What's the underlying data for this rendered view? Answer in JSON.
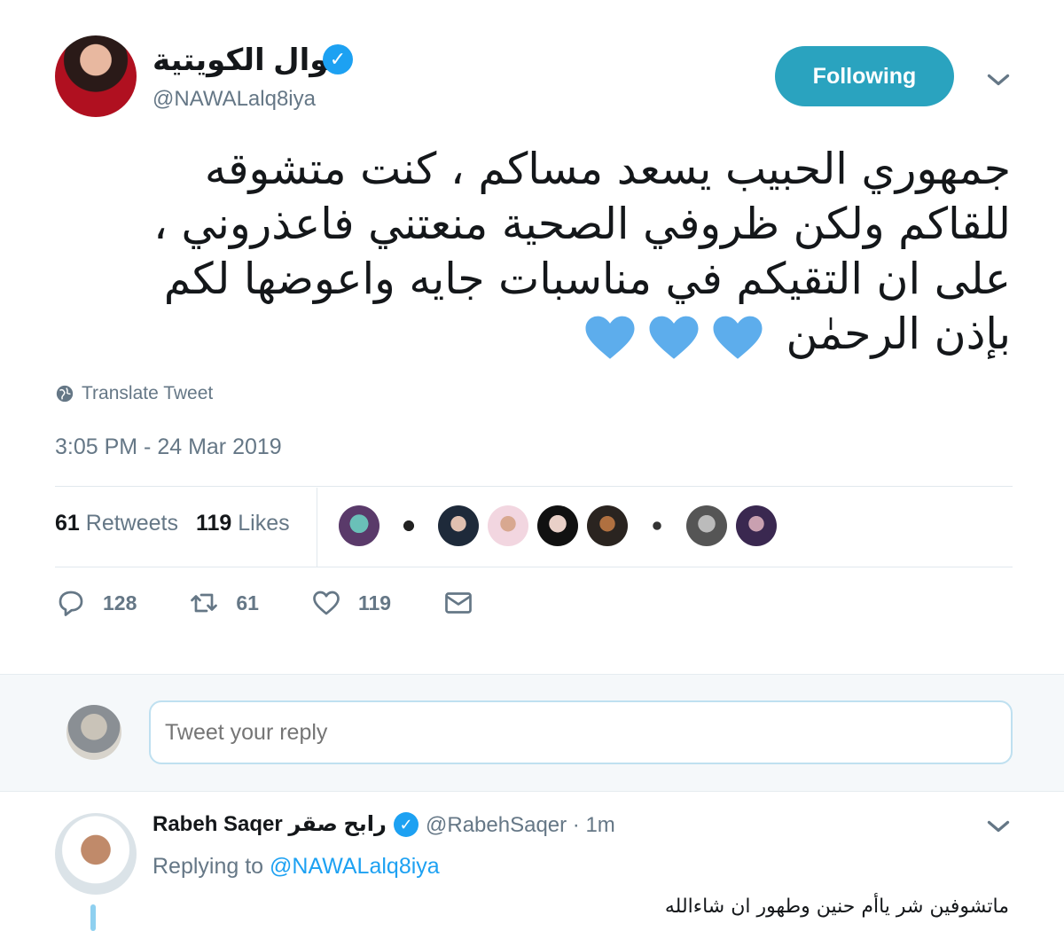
{
  "tweet": {
    "author": {
      "display_name": "نوال الكويتية",
      "handle": "@NAWALalq8iya",
      "verified": true
    },
    "follow_button_label": "Following",
    "text": "جمهوري الحبيب يسعد مساكم ، كنت متشوقه للقاكم ولكن ظروفي الصحية منعتني فاعذروني ، على ان التقيكم في مناسبات جايه واعوضها لكم بإذن الرحمٰن",
    "hearts": [
      "blue-heart",
      "blue-heart",
      "blue-heart"
    ],
    "translate_label": "Translate Tweet",
    "timestamp": "3:05 PM - 24 Mar 2019",
    "stats": {
      "retweets_count": "61",
      "retweets_label": "Retweets",
      "likes_count": "119",
      "likes_label": "Likes"
    },
    "liker_avatars": 9,
    "actions": {
      "reply_count": "128",
      "retweet_count": "61",
      "like_count": "119"
    },
    "accent_color": "#1da1f2",
    "follow_button_color": "#2aa3bf"
  },
  "reply_box": {
    "placeholder": "Tweet your reply"
  },
  "reply_tweet": {
    "name": "Rabeh Saqer رابح صقر",
    "verified": true,
    "handle_time": "@RabehSaqer · 1m",
    "replying_prefix": "Replying to",
    "replying_to": "@NAWALalq8iya",
    "text": "ماتشوفين شر ياأم حنين وطهور ان شاءالله"
  }
}
